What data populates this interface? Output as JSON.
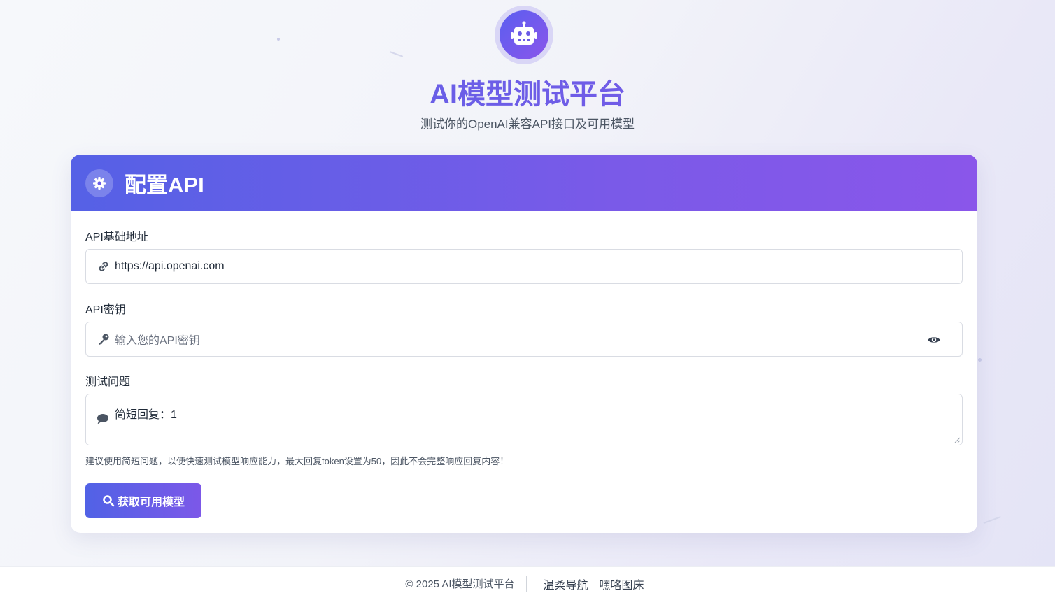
{
  "header": {
    "icon": "robot-icon",
    "title": "AI模型测试平台",
    "subtitle": "测试你的OpenAI兼容API接口及可用模型"
  },
  "card": {
    "icon": "gear-icon",
    "title": "配置API",
    "base_url": {
      "label": "API基础地址",
      "icon": "link-icon",
      "value": "https://api.openai.com"
    },
    "api_key": {
      "label": "API密钥",
      "icon": "key-icon",
      "placeholder": "输入您的API密钥",
      "toggle_icon": "eye-icon"
    },
    "question": {
      "label": "测试问题",
      "icon": "comment-icon",
      "value": "简短回复：1",
      "hint": "建议使用简短问题，以便快速测试模型响应能力，最大回复token设置为50，因此不会完整响应回复内容！"
    },
    "fetch_button": {
      "icon": "search-icon",
      "label": "获取可用模型"
    }
  },
  "footer": {
    "copyright": "© 2025 AI模型测试平台",
    "links": [
      "温柔导航",
      "嘿咯图床"
    ]
  },
  "colors": {
    "accent_start": "#5162e6",
    "accent_end": "#8a56ea",
    "title_color": "#6a5ae6"
  }
}
